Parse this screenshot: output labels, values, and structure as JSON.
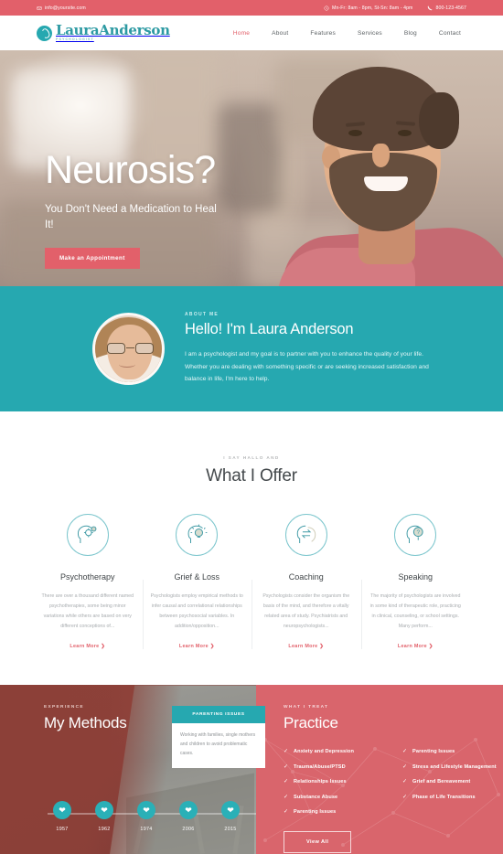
{
  "topbar": {
    "email": "info@yoursite.com",
    "email_icon": "envelope-icon",
    "hours": "Mn-Fr: 8am - 8pm, St-Sn: 8am - 4pm",
    "hours_icon": "clock-icon",
    "phone": "800-123-4567",
    "phone_icon": "phone-icon",
    "bg": "#e2606a"
  },
  "header": {
    "logo_name": "LauraAnderson",
    "logo_sub": "PSYCHOLOGIST",
    "logo_icon": "brand-circle-icon",
    "nav": [
      {
        "label": "Home",
        "active": true
      },
      {
        "label": "About",
        "active": false
      },
      {
        "label": "Features",
        "active": false
      },
      {
        "label": "Services",
        "active": false
      },
      {
        "label": "Blog",
        "active": false
      },
      {
        "label": "Contact",
        "active": false
      }
    ]
  },
  "hero": {
    "title": "Neurosis?",
    "subtitle": "You Don't Need a Medication to Heal It!",
    "button": "Make an Appointment",
    "accent": "#e2606a"
  },
  "about": {
    "kicker": "ABOUT ME",
    "title": "Hello! I'm Laura Anderson",
    "text": "I am a psychologist and my goal is to partner with you to enhance the quality of your life. Whether you are dealing with something specific or are seeking increased satisfaction and balance in life, I'm here to help.",
    "bg": "#26a8b0",
    "avatar_icon": "avatar"
  },
  "offer": {
    "kicker": "I SAY HALLO AND",
    "title": "What I Offer",
    "cards": [
      {
        "icon": "head-gears-icon",
        "title": "Psychotherapy",
        "text": "There are over a thousand different named psychotherapies, some being minor variations while others are based on very different conceptions of...",
        "link": "Learn More"
      },
      {
        "icon": "head-lightbulb-icon",
        "title": "Grief & Loss",
        "text": "Psychologists employ empirical methods to infer causal and correlational relationships between psychosocial variables. In addition/opposition...",
        "link": "Learn More"
      },
      {
        "icon": "head-exchange-icon",
        "title": "Coaching",
        "text": "Psychologists consider the organism the basis of the mind, and therefore a vitally related area of study. Psychiatrists and neuropsychologists...",
        "link": "Learn More"
      },
      {
        "icon": "head-question-icon",
        "title": "Speaking",
        "text": "The majority of psychologists are involved in some kind of therapeutic role, practicing in clinical, counseling, or school settings. Many perform...",
        "link": "Learn More"
      }
    ]
  },
  "methods": {
    "kicker": "EXPERIENCE",
    "title": "My Methods",
    "tooltip": {
      "heading": "PARENTING ISSUES",
      "body": "Working with families, single mothers and children to avoid problematic cases."
    },
    "timeline": [
      {
        "year": "1957",
        "icon": "heart-icon"
      },
      {
        "year": "1962",
        "icon": "heart-icon"
      },
      {
        "year": "1974",
        "icon": "heart-icon"
      },
      {
        "year": "2006",
        "icon": "heart-icon"
      },
      {
        "year": "2015",
        "icon": "heart-icon"
      }
    ]
  },
  "practice": {
    "kicker": "WHAT I TREAT",
    "title": "Practice",
    "bg": "#d9656c",
    "left_items": [
      "Anxiety and Depression",
      "Trauma/Abuse/PTSD",
      "Relationships Issues",
      "Substance Abuse",
      "Parenting Issues"
    ],
    "right_items": [
      "Parenting Issues",
      "Stress and Lifestyle Management",
      "Grief and Bereavement",
      "Phase of Life Transitions"
    ],
    "check_icon": "check-icon",
    "button": "View All"
  }
}
